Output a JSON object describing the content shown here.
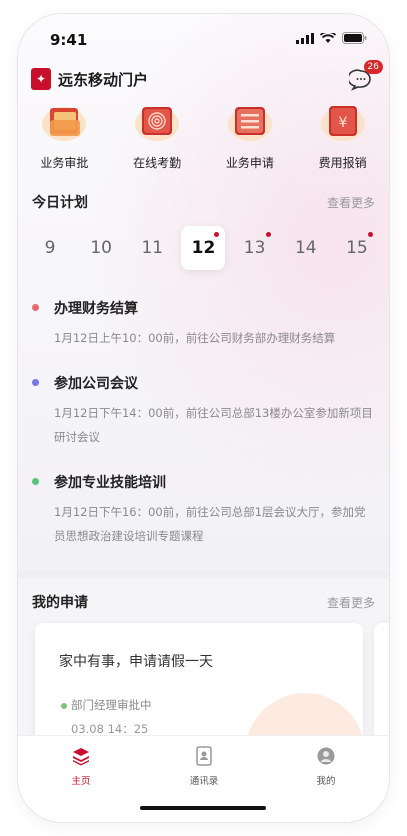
{
  "status_bar": {
    "time": "9:41"
  },
  "header": {
    "app_title": "远东移动门户",
    "message_badge": "26"
  },
  "quick_actions": [
    {
      "label": "业务审批",
      "icon": "folder-icon"
    },
    {
      "label": "在线考勤",
      "icon": "fingerprint-icon"
    },
    {
      "label": "业务申请",
      "icon": "form-list-icon"
    },
    {
      "label": "费用报销",
      "icon": "yen-receipt-icon"
    }
  ],
  "today_plan": {
    "title": "今日计划",
    "more": "查看更多",
    "days": [
      {
        "label": "9",
        "has_event": false,
        "selected": false
      },
      {
        "label": "10",
        "has_event": false,
        "selected": false
      },
      {
        "label": "11",
        "has_event": false,
        "selected": false
      },
      {
        "label": "12",
        "has_event": true,
        "selected": true
      },
      {
        "label": "13",
        "has_event": true,
        "selected": false
      },
      {
        "label": "14",
        "has_event": false,
        "selected": false
      },
      {
        "label": "15",
        "has_event": true,
        "selected": false
      }
    ],
    "items": [
      {
        "title": "办理财务结算",
        "desc": "1月12日上午10：00前，前往公司财务部办理财务结算",
        "color": "#e46a72"
      },
      {
        "title": "参加公司会议",
        "desc": "1月12日下午14：00前，前往公司总部13楼办公室参加新项目研讨会议",
        "color": "#7b75e8"
      },
      {
        "title": "参加专业技能培训",
        "desc": "1月12日下午16：00前，前往公司总部1层会议大厅，参加党员思想政治建设培训专题课程",
        "color": "#5cc37a"
      }
    ]
  },
  "my_applications": {
    "title": "我的申请",
    "more": "查看更多",
    "card": {
      "title": "家中有事，申请请假一天",
      "status": "部门经理审批中",
      "time": "03.08  14：25"
    }
  },
  "tabbar": [
    {
      "label": "主页",
      "icon": "home-stack-icon",
      "active": true
    },
    {
      "label": "通讯录",
      "icon": "contacts-book-icon",
      "active": false
    },
    {
      "label": "我的",
      "icon": "profile-icon",
      "active": false
    }
  ],
  "colors": {
    "brand": "#c8102e",
    "badge": "#d42a2a"
  }
}
